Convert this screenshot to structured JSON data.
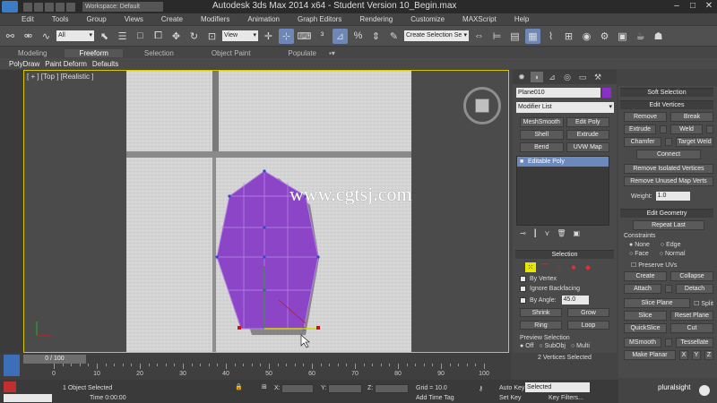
{
  "titlebar": {
    "workspace": "Workspace: Default",
    "title": "Autodesk 3ds Max  2014 x64   - Student Version    10_Begin.max"
  },
  "menu": [
    "Edit",
    "Tools",
    "Group",
    "Views",
    "Create",
    "Modifiers",
    "Animation",
    "Graph Editors",
    "Rendering",
    "Customize",
    "MAXScript",
    "Help"
  ],
  "toolbar": {
    "selection_filter": "All",
    "reference_coord": "View",
    "named_selection": "Create Selection Se"
  },
  "ribbon": {
    "tabs": [
      "Modeling",
      "Freeform",
      "Selection",
      "Object Paint",
      "Populate"
    ],
    "active_tab": "Freeform",
    "subtabs": [
      "PolyDraw",
      "Paint Deform",
      "Defaults"
    ]
  },
  "viewport": {
    "label": "[ + ] [Top ] [Realistic ]",
    "watermark": "www.cgtsj.com",
    "accent_color": "#d9c800",
    "mesh_color": "#8d45c8"
  },
  "command_panel": {
    "object_name": "Plane010",
    "object_color": "#8b2fc9",
    "modifier_list": "Modifier List",
    "modifier_buttons": [
      "MeshSmooth",
      "Edit Poly",
      "Shell",
      "Extrude",
      "Bend",
      "UVW Map"
    ],
    "stack_entry": "Editable Poly",
    "selection": {
      "title": "Selection",
      "by_vertex": "By Vertex",
      "ignore_backfacing": "Ignore Backfacing",
      "by_angle": "By Angle:",
      "by_angle_value": "45.0",
      "shrink": "Shrink",
      "grow": "Grow",
      "ring": "Ring",
      "loop": "Loop",
      "preview_title": "Preview Selection",
      "preview_off": "Off",
      "preview_subobj": "SubObj",
      "preview_multi": "Multi",
      "status": "2 Vertices Selected"
    }
  },
  "right_panel": {
    "soft_selection": "Soft Selection",
    "edit_vertices": "Edit Vertices",
    "remove": "Remove",
    "break": "Break",
    "extrude": "Extrude",
    "weld": "Weld",
    "chamfer": "Chamfer",
    "target_weld": "Target Weld",
    "connect": "Connect",
    "remove_isolated": "Remove Isolated Vertices",
    "remove_unused_map": "Remove Unused Map Verts",
    "weight_label": "Weight:",
    "weight_value": "1.0",
    "edit_geometry": "Edit Geometry",
    "repeat_last": "Repeat Last",
    "constraints": "Constraints",
    "c_none": "None",
    "c_edge": "Edge",
    "c_face": "Face",
    "c_normal": "Normal",
    "preserve_uvs": "Preserve UVs",
    "create": "Create",
    "collapse": "Collapse",
    "attach": "Attach",
    "detach": "Detach",
    "slice_plane": "Slice Plane",
    "split": "Split",
    "slice": "Slice",
    "reset_plane": "Reset Plane",
    "quickslice": "QuickSlice",
    "cut": "Cut",
    "msmooth": "MSmooth",
    "tessellate": "Tessellate",
    "make_planar": "Make Planar",
    "x": "X",
    "y": "Y",
    "z": "Z"
  },
  "timeline": {
    "frame": "0 / 100",
    "ticks": [
      "0",
      "10",
      "20",
      "30",
      "40",
      "50",
      "60",
      "70",
      "80",
      "90",
      "100"
    ]
  },
  "statusbar": {
    "selected": "1 Object Selected",
    "x_label": "X:",
    "y_label": "Y:",
    "z_label": "Z:",
    "grid": "Grid = 10.0",
    "add_time_tag": "Add Time Tag",
    "time": "Time  0:00:00",
    "auto_key": "Auto Key",
    "set_key": "Set Key",
    "selected_dropdown": "Selected",
    "key_filters": "Key Filters..."
  },
  "brand": "pluralsight"
}
